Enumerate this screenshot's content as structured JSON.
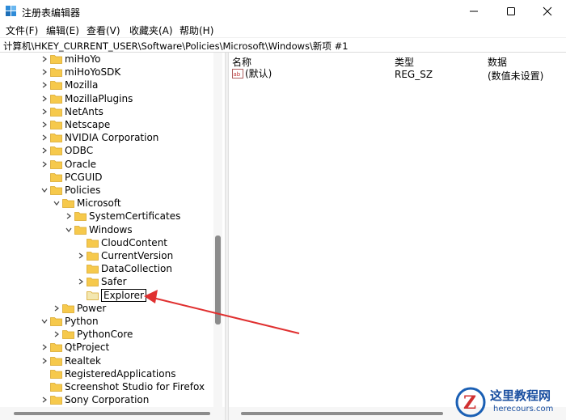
{
  "window": {
    "title": "注册表编辑器"
  },
  "menu": [
    "文件(F)",
    "编辑(E)",
    "查看(V)",
    "收藏夹(A)",
    "帮助(H)"
  ],
  "address": "计算机\\HKEY_CURRENT_USER\\Software\\Policies\\Microsoft\\Windows\\新项 #1",
  "tree": [
    {
      "label": "miHoYo",
      "depth": 0,
      "expander": "collapsed"
    },
    {
      "label": "miHoYoSDK",
      "depth": 0,
      "expander": "collapsed"
    },
    {
      "label": "Mozilla",
      "depth": 0,
      "expander": "collapsed"
    },
    {
      "label": "MozillaPlugins",
      "depth": 0,
      "expander": "collapsed"
    },
    {
      "label": "NetAnts",
      "depth": 0,
      "expander": "collapsed"
    },
    {
      "label": "Netscape",
      "depth": 0,
      "expander": "collapsed"
    },
    {
      "label": "NVIDIA Corporation",
      "depth": 0,
      "expander": "collapsed"
    },
    {
      "label": "ODBC",
      "depth": 0,
      "expander": "collapsed"
    },
    {
      "label": "Oracle",
      "depth": 0,
      "expander": "collapsed"
    },
    {
      "label": "PCGUID",
      "depth": 0,
      "expander": "none"
    },
    {
      "label": "Policies",
      "depth": 0,
      "expander": "expanded"
    },
    {
      "label": "Microsoft",
      "depth": 1,
      "expander": "expanded"
    },
    {
      "label": "SystemCertificates",
      "depth": 2,
      "expander": "collapsed"
    },
    {
      "label": "Windows",
      "depth": 2,
      "expander": "expanded"
    },
    {
      "label": "CloudContent",
      "depth": 3,
      "expander": "none"
    },
    {
      "label": "CurrentVersion",
      "depth": 3,
      "expander": "collapsed"
    },
    {
      "label": "DataCollection",
      "depth": 3,
      "expander": "none"
    },
    {
      "label": "Safer",
      "depth": 3,
      "expander": "collapsed"
    },
    {
      "label": "Explorer",
      "depth": 3,
      "expander": "none",
      "editing": true
    },
    {
      "label": "Power",
      "depth": 1,
      "expander": "collapsed"
    },
    {
      "label": "Python",
      "depth": 0,
      "expander": "expanded"
    },
    {
      "label": "PythonCore",
      "depth": 1,
      "expander": "collapsed"
    },
    {
      "label": "QtProject",
      "depth": 0,
      "expander": "collapsed"
    },
    {
      "label": "Realtek",
      "depth": 0,
      "expander": "collapsed"
    },
    {
      "label": "RegisteredApplications",
      "depth": 0,
      "expander": "none"
    },
    {
      "label": "Screenshot Studio for Firefox",
      "depth": 0,
      "expander": "none"
    },
    {
      "label": "Sony Corporation",
      "depth": 0,
      "expander": "collapsed"
    }
  ],
  "columns": [
    "名称",
    "类型",
    "数据"
  ],
  "values": [
    {
      "name": "(默认)",
      "type": "REG_SZ",
      "data": "(数值未设置)"
    }
  ],
  "watermark": {
    "text": "这里教程网",
    "url": "herecours.com"
  }
}
